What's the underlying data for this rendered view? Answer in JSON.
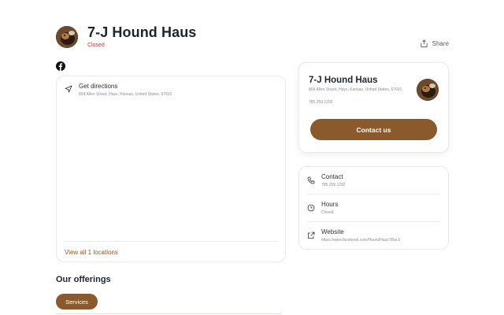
{
  "header": {
    "business_name": "7-J Hound Haus",
    "status": "Closed",
    "share_label": "Share"
  },
  "icons": {
    "avatar": "dog-photo-avatar",
    "share": "share-icon",
    "facebook": "facebook-icon",
    "directions": "navigation-arrow-icon",
    "phone": "phone-icon",
    "clock": "clock-icon",
    "website": "external-link-icon"
  },
  "location": {
    "directions_label": "Get directions",
    "address": "804 Allen Street, Hays, Kansas, United States, 67601",
    "view_all_label": "View all 1 locations"
  },
  "offerings": {
    "title": "Our offerings",
    "chips": [
      "Services"
    ]
  },
  "profile_card": {
    "title": "7-J Hound Haus",
    "address": "804 Allen Street, Hays, Kansas, United States, 67601",
    "phone": "785 259 1292",
    "contact_button": "Contact us"
  },
  "info": {
    "contact_label": "Contact",
    "contact_value": "785 259 1292",
    "hours_label": "Hours",
    "hours_value": "Closed",
    "website_label": "Website",
    "website_value": "https://www.facebook.com/HoundHaus7BarJ/"
  },
  "colors": {
    "accent": "#8a5a2c",
    "closed": "#c23b3b"
  }
}
